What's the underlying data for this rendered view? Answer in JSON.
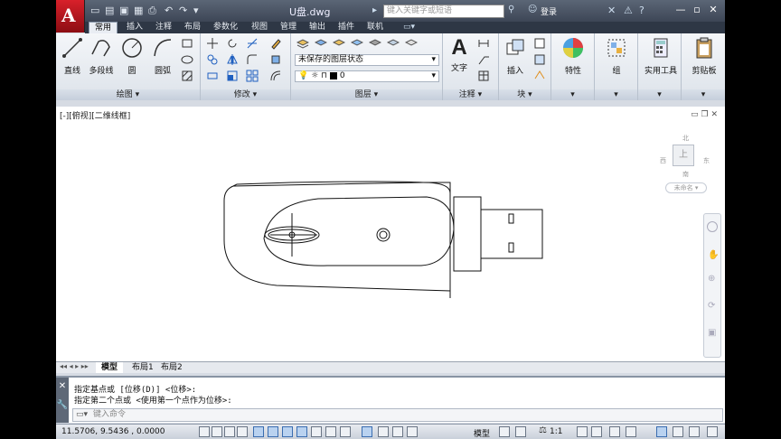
{
  "title_bar": {
    "doc_title": "U盘.dwg",
    "search_placeholder": "键入关键字或短语",
    "login_label": "登录",
    "qat_icons": [
      "new-icon",
      "open-icon",
      "save-icon",
      "saveas-icon",
      "print-icon",
      "undo-icon",
      "redo-icon",
      "more-icon"
    ]
  },
  "tabs": [
    "常用",
    "插入",
    "注释",
    "布局",
    "参数化",
    "视图",
    "管理",
    "输出",
    "插件",
    "联机"
  ],
  "active_tab": "常用",
  "ribbon": {
    "draw": {
      "title": "绘图",
      "buttons": [
        "直线",
        "多段线",
        "圆",
        "圆弧"
      ]
    },
    "modify": {
      "title": "修改"
    },
    "layers": {
      "title": "图层",
      "state_dropdown": "未保存的图层状态",
      "layer_dropdown": "0"
    },
    "annotation": {
      "title": "注释",
      "text_label": "文字"
    },
    "block": {
      "title": "块",
      "insert_label": "插入"
    },
    "properties": {
      "label": "特性"
    },
    "groups": {
      "label": "组"
    },
    "utilities": {
      "label": "实用工具"
    },
    "clipboard": {
      "label": "剪贴板"
    }
  },
  "drawing": {
    "view_label": "[-][俯视][二维线框]",
    "viewcube": {
      "top": "上",
      "north": "北",
      "west": "西",
      "east": "东",
      "south": "南",
      "wcs": "未命名"
    }
  },
  "layout_tabs": [
    "模型",
    "布局1",
    "布局2"
  ],
  "active_layout": "模型",
  "command": {
    "history": [
      "指定基点或 [位移(D)] <位移>:",
      "指定第二个点或 <使用第一个点作为位移>:"
    ],
    "input_placeholder": "键入命令"
  },
  "status": {
    "coords": "11.5706,  9.5436 , 0.0000",
    "model": "模型",
    "scale": "1:1"
  },
  "colors": {
    "app_button": "#c8141e",
    "ribbon_bg": "#eef1f5",
    "title_bg": "#4a5464"
  }
}
